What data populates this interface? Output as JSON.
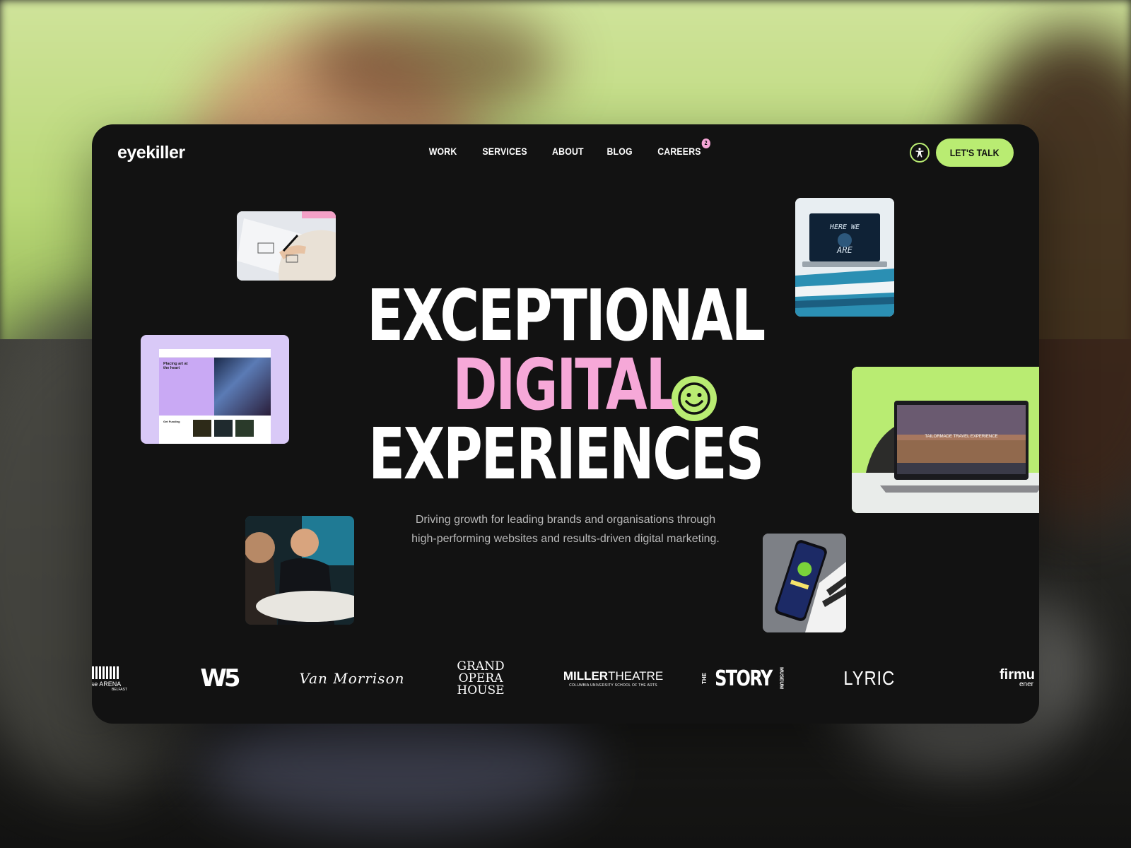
{
  "brand": {
    "logo_text": "eyekiller"
  },
  "nav": {
    "items": [
      {
        "label": "WORK"
      },
      {
        "label": "SERVICES"
      },
      {
        "label": "ABOUT"
      },
      {
        "label": "BLOG"
      },
      {
        "label": "CAREERS",
        "badge": "2"
      }
    ]
  },
  "header": {
    "cta_label": "LET'S TALK",
    "accessibility_icon": "accessibility-icon"
  },
  "hero": {
    "line1": "EXCEPTIONAL",
    "line2": "DIGITAL",
    "line3": "EXPERIENCES",
    "subtitle_line1": "Driving growth for leading brands and organisations through",
    "subtitle_line2": "high-performing websites and results-driven digital marketing."
  },
  "thumbnails": {
    "sketch": {
      "icon": "sketching-hand-photo"
    },
    "website": {
      "heading": "Placing art at the heart",
      "section": "Get Funding"
    },
    "team": {
      "icon": "team-meeting-photo"
    },
    "laptop_stack": {
      "text_top": "HERE WE",
      "text_bottom": "ARE"
    },
    "travel": {
      "headline": "TAILORMADE TRAVEL EXPERIENCE"
    },
    "phone": {
      "icon": "phone-app-photo"
    }
  },
  "clients": {
    "arena": {
      "name": "SSE ARENA",
      "visible_name": "se ARENA",
      "city": "BELFAST"
    },
    "w5": {
      "name": "W5"
    },
    "van_morrison": {
      "name": "Van Morrison"
    },
    "grand_opera": {
      "line1": "GRAND",
      "line2": "OPERA",
      "line3": "HOUSE"
    },
    "miller": {
      "bold": "MILLER",
      "light": "THEATRE",
      "sub": "COLUMBIA UNIVERSITY SCHOOL OF THE ARTS"
    },
    "story": {
      "prefix": "THE",
      "main": "STORY",
      "suffix": "MUSEUM"
    },
    "lyric": {
      "name": "LYRIC"
    },
    "firmus": {
      "name": "firmu",
      "sub": "ener"
    }
  },
  "colors": {
    "background": "#121212",
    "accent_green": "#b9ec72",
    "accent_pink": "#f6a8d8",
    "purple_card": "#d9c9f7"
  }
}
